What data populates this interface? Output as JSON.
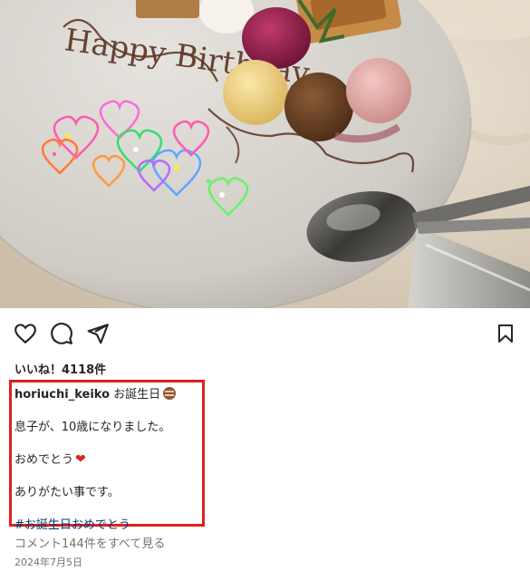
{
  "post": {
    "likes_label": "いいね！4118件",
    "username": "horiuchi_keiko",
    "caption_title": "お誕生日",
    "caption_line1": "息子が、10歳になりました。",
    "caption_line2": "おめでとう",
    "caption_line3": "ありがたい事です。",
    "hashtag": "#お誕生日おめでとう",
    "comments_link": "コメント144件をすべて見る",
    "date": "2024年7月5日"
  },
  "photo": {
    "plate_text": "Happy Birthday"
  },
  "icons": {
    "like": "heart-outline-icon",
    "comment": "speech-bubble-icon",
    "share": "paper-plane-icon",
    "save": "bookmark-icon",
    "cake": "cake-emoji-icon",
    "heart": "red-heart-emoji-icon"
  },
  "colors": {
    "highlight_box": "#e0201e",
    "hashtag": "#00376b",
    "muted_text": "#737373",
    "heart_emoji": "#d62b1f"
  }
}
